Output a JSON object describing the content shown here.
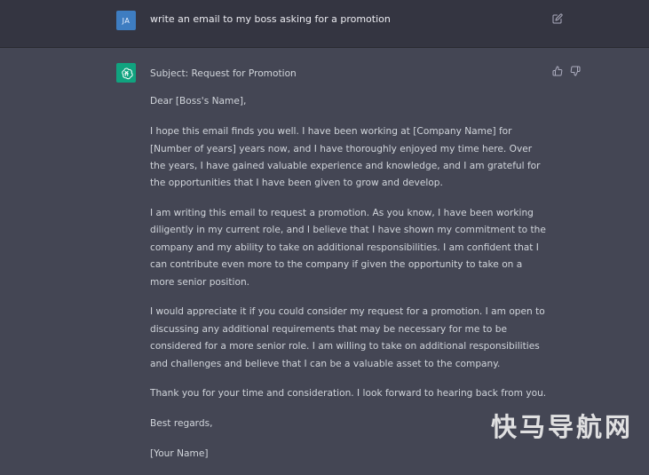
{
  "user_message": {
    "avatar_initials": "JA",
    "text": "write an email to my boss asking for a promotion",
    "edit_icon": "edit-icon"
  },
  "assistant_message": {
    "avatar_icon": "openai-logo-icon",
    "feedback_icons": [
      "thumbs-up-icon",
      "thumbs-down-icon"
    ],
    "paragraphs": [
      "Subject: Request for Promotion",
      "Dear [Boss's Name],",
      "I hope this email finds you well. I have been working at [Company Name] for [Number of years] years now, and I have thoroughly enjoyed my time here. Over the years, I have gained valuable experience and knowledge, and I am grateful for the opportunities that I have been given to grow and develop.",
      "I am writing this email to request a promotion. As you know, I have been working diligently in my current role, and I believe that I have shown my commitment to the company and my ability to take on additional responsibilities. I am confident that I can contribute even more to the company if given the opportunity to take on a more senior position.",
      "I would appreciate it if you could consider my request for a promotion. I am open to discussing any additional requirements that may be necessary for me to be considered for a more senior role. I am willing to take on additional responsibilities and challenges and believe that I can be a valuable asset to the company.",
      "Thank you for your time and consideration. I look forward to hearing back from you.",
      "Best regards,",
      "[Your Name]"
    ]
  },
  "watermark": "快马导航网",
  "colors": {
    "user_bg": "#343541",
    "assistant_bg": "#444654",
    "user_avatar": "#3e7dc1",
    "bot_avatar": "#10a37f",
    "text": "#d1d5db"
  }
}
